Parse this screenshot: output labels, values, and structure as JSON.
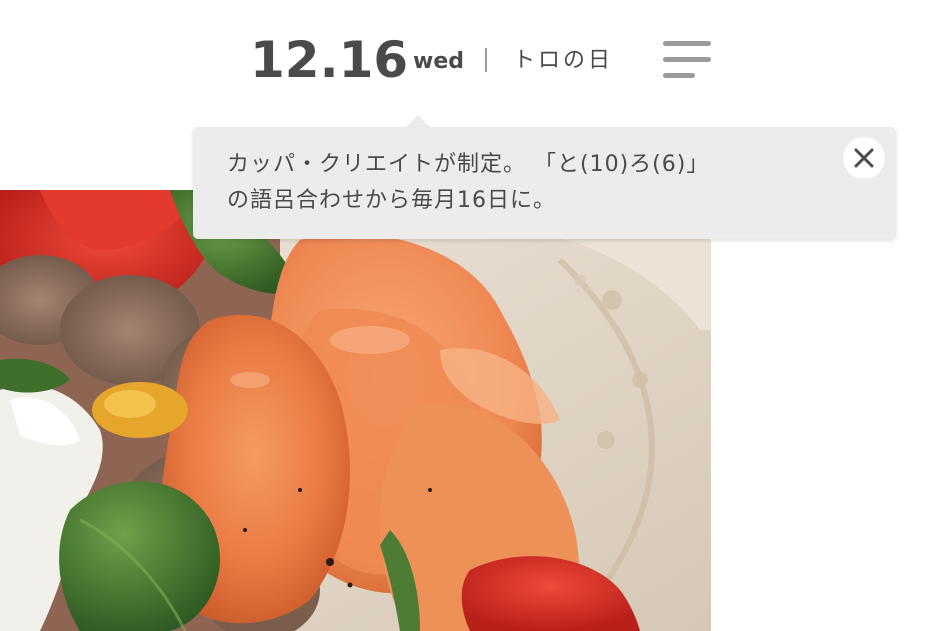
{
  "header": {
    "date_day": "12.16",
    "weekday": "wed",
    "day_name": "トロの日"
  },
  "menu": {
    "icon": "hamburger-menu-icon"
  },
  "tooltip": {
    "line1": "カッパ・クリエイトが制定。 「と(10)ろ(6)」",
    "line2": "の語呂合わせから毎月16日に。",
    "close_icon": "close-icon"
  },
  "hero": {
    "image": "food-photo"
  }
}
